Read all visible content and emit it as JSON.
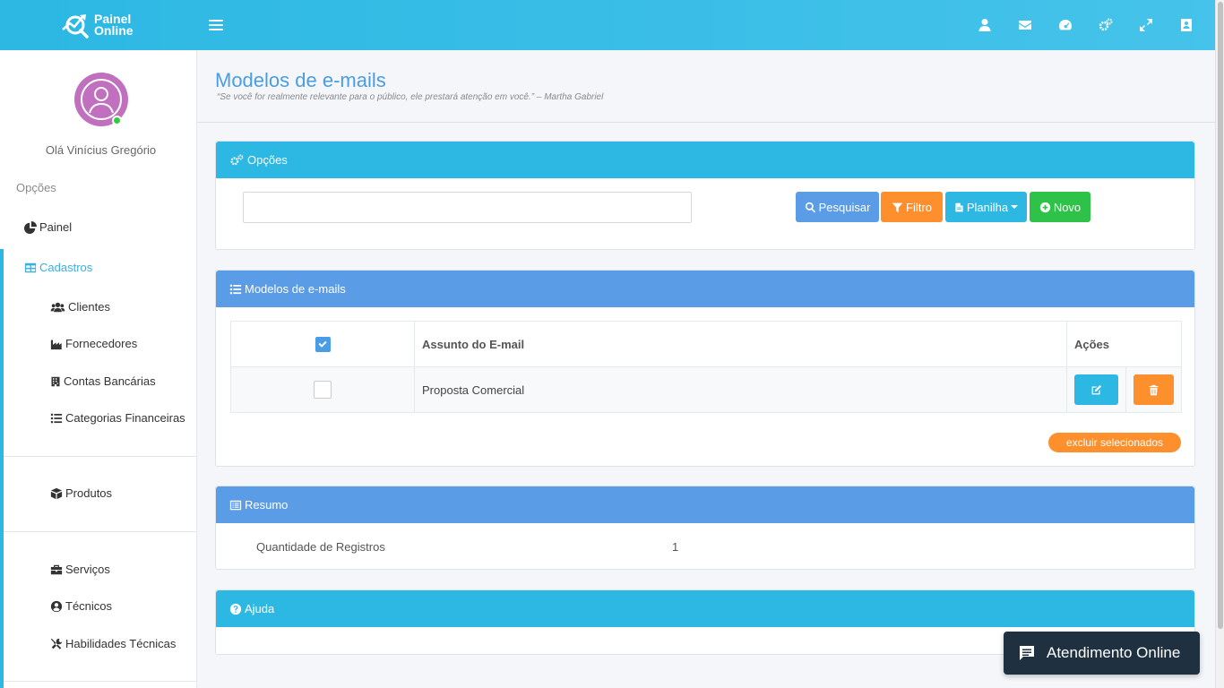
{
  "brand": {
    "line1": "Painel",
    "line2": "Online"
  },
  "topbar": {
    "icons": [
      "user-icon",
      "envelope-icon",
      "dashboard-icon",
      "settings-icon",
      "expand-icon",
      "contact-book-icon"
    ]
  },
  "sidebar": {
    "greeting": "Olá Vinícius Gregório",
    "section_label": "Opções",
    "items": [
      {
        "label": "Painel",
        "icon": "pie-chart-icon"
      },
      {
        "label": "Cadastros",
        "icon": "table-icon"
      },
      {
        "label": "Clientes",
        "icon": "users-icon"
      },
      {
        "label": "Fornecedores",
        "icon": "industry-icon"
      },
      {
        "label": "Contas Bancárias",
        "icon": "building-icon"
      },
      {
        "label": "Categorias Financeiras",
        "icon": "list-icon"
      },
      {
        "label": "Produtos",
        "icon": "box-icon"
      },
      {
        "label": "Serviços",
        "icon": "briefcase-icon"
      },
      {
        "label": "Técnicos",
        "icon": "user-circle-icon"
      },
      {
        "label": "Habilidades Técnicas",
        "icon": "tools-icon"
      }
    ]
  },
  "header": {
    "title": "Modelos de e-mails",
    "quote": "“Se você for realmente relevante para o público, ele prestará atenção em você.” – Martha Gabriel"
  },
  "options_panel": {
    "title": "Opções",
    "search_placeholder": "",
    "buttons": {
      "search": "Pesquisar",
      "filter": "Filtro",
      "sheet": "Planilha",
      "new": "Novo"
    }
  },
  "list_panel": {
    "title": "Modelos de e-mails",
    "columns": [
      "",
      "Assunto do E-mail",
      "Ações"
    ],
    "rows": [
      {
        "subject": "Proposta Comercial",
        "checked": false
      }
    ],
    "delete_selected": "excluir selecionados"
  },
  "summary_panel": {
    "title": "Resumo",
    "label": "Quantidade de Registros",
    "value": "1"
  },
  "help_panel": {
    "title": "Ajuda"
  },
  "chat": {
    "label": "Atendimento Online"
  },
  "colors": {
    "cyan": "#2cb8e3",
    "blue": "#5b9ce6",
    "orange": "#fd8f2c",
    "green": "#2ec348",
    "chat": "#1f3040"
  }
}
